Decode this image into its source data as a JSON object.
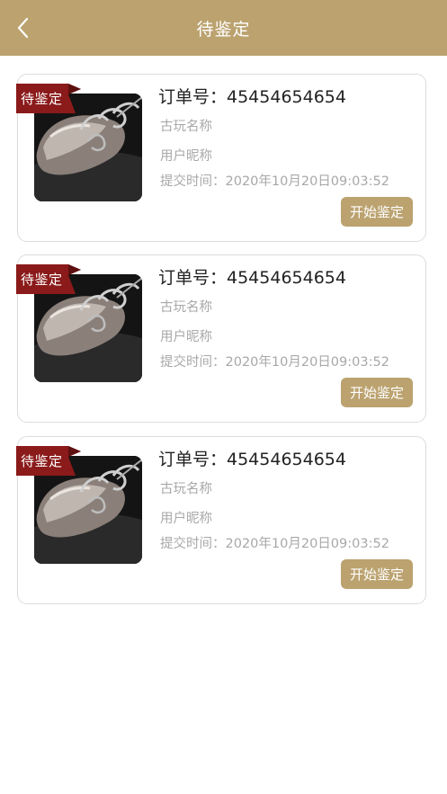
{
  "header": {
    "title": "待鉴定",
    "back_icon": "chevron-left-icon",
    "background": "#bba26f"
  },
  "orders": [
    {
      "badge": "待鉴定",
      "order_no": "订单号：45454654654",
      "item_name": "古玩名称",
      "user_nickname": "用户昵称",
      "submit_time": "提交时间：2020年10月20日09:03:52",
      "action_label": "开始鉴定"
    },
    {
      "badge": "待鉴定",
      "order_no": "订单号：45454654654",
      "item_name": "古玩名称",
      "user_nickname": "用户昵称",
      "submit_time": "提交时间：2020年10月20日09:03:52",
      "action_label": "开始鉴定"
    },
    {
      "badge": "待鉴定",
      "order_no": "订单号：45454654654",
      "item_name": "古玩名称",
      "user_nickname": "用户昵称",
      "submit_time": "提交时间：2020年10月20日09:03:52",
      "action_label": "开始鉴定"
    }
  ],
  "colors": {
    "accent": "#bba26f",
    "badge": "#8b1a1a",
    "muted_text": "#a8a8a8"
  }
}
